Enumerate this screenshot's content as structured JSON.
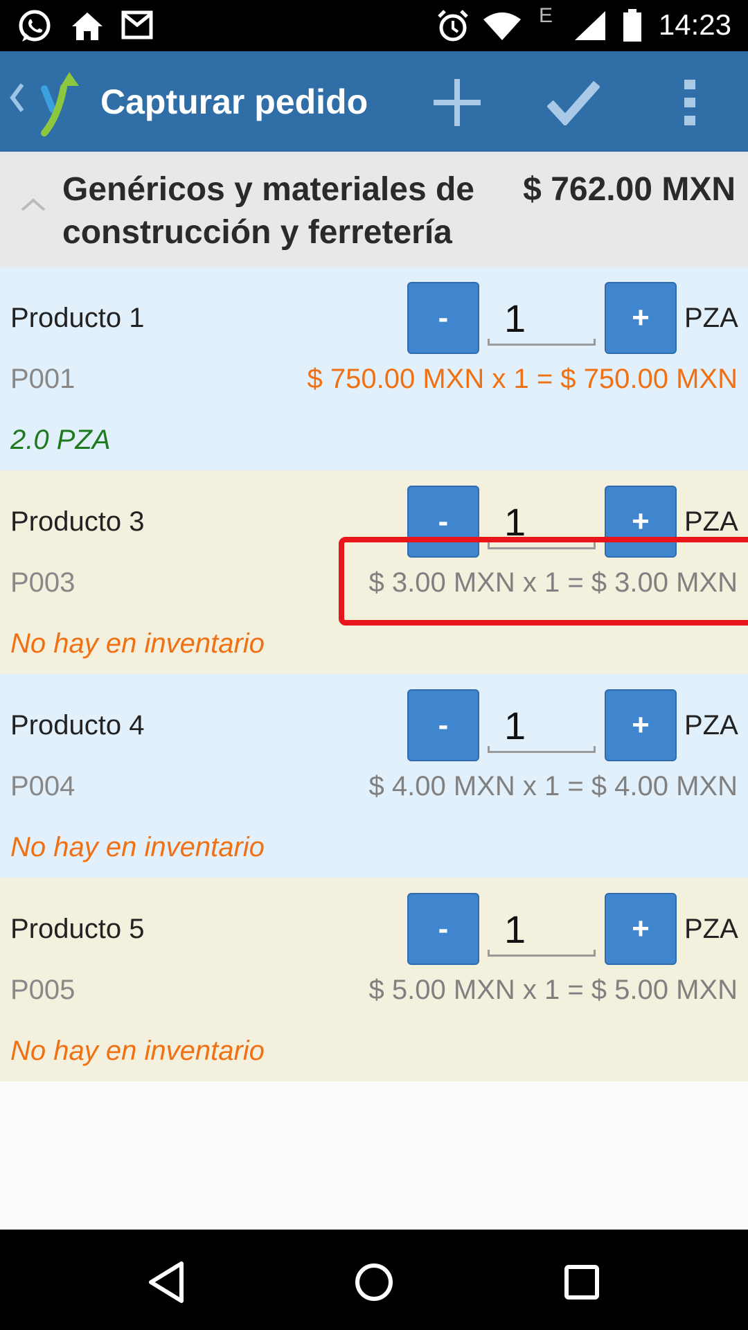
{
  "status_bar": {
    "time": "14:23",
    "network_label": "E",
    "left_icons": [
      "whatsapp-icon",
      "home-icon",
      "gmail-icon"
    ],
    "right_icons": [
      "alarm-icon",
      "wifi-icon",
      "signal-icon",
      "battery-icon"
    ]
  },
  "action_bar": {
    "title": "Capturar pedido",
    "actions": [
      "add-icon",
      "confirm-check-icon",
      "overflow-menu-icon"
    ],
    "background": "#2f6ea6"
  },
  "group": {
    "name": "Genéricos y materiales de construcción y ferretería",
    "total": "$ 762.00 MXN"
  },
  "products": [
    {
      "name": "Producto 1",
      "code": "P001",
      "quantity": "1",
      "unit": "PZA",
      "price_line": "$ 750.00 MXN x 1 = $ 750.00 MXN",
      "stock": "2.0 PZA",
      "minus": "-",
      "plus": "+"
    },
    {
      "name": "Producto 3",
      "code": "P003",
      "quantity": "1",
      "unit": "PZA",
      "price_line": "$ 3.00 MXN x 1 = $ 3.00 MXN",
      "stock": "No hay en inventario",
      "minus": "-",
      "plus": "+"
    },
    {
      "name": "Producto 4",
      "code": "P004",
      "quantity": "1",
      "unit": "PZA",
      "price_line": "$ 4.00 MXN x 1 = $ 4.00 MXN",
      "stock": "No hay en inventario",
      "minus": "-",
      "plus": "+"
    },
    {
      "name": "Producto 5",
      "code": "P005",
      "quantity": "1",
      "unit": "PZA",
      "price_line": "$ 5.00 MXN x 1 = $ 5.00 MXN",
      "stock": "No hay en inventario",
      "minus": "-",
      "plus": "+"
    }
  ],
  "colors": {
    "row_blue": "#e1f0fb",
    "row_beige": "#f4f0de",
    "button_blue": "#3f86cf",
    "warning_orange": "#f07014",
    "in_stock_green": "#1f7a1f",
    "highlight_red": "#e8161b"
  },
  "nav_bar": {
    "buttons": [
      "back-triangle-icon",
      "home-circle-icon",
      "recents-square-icon"
    ]
  }
}
